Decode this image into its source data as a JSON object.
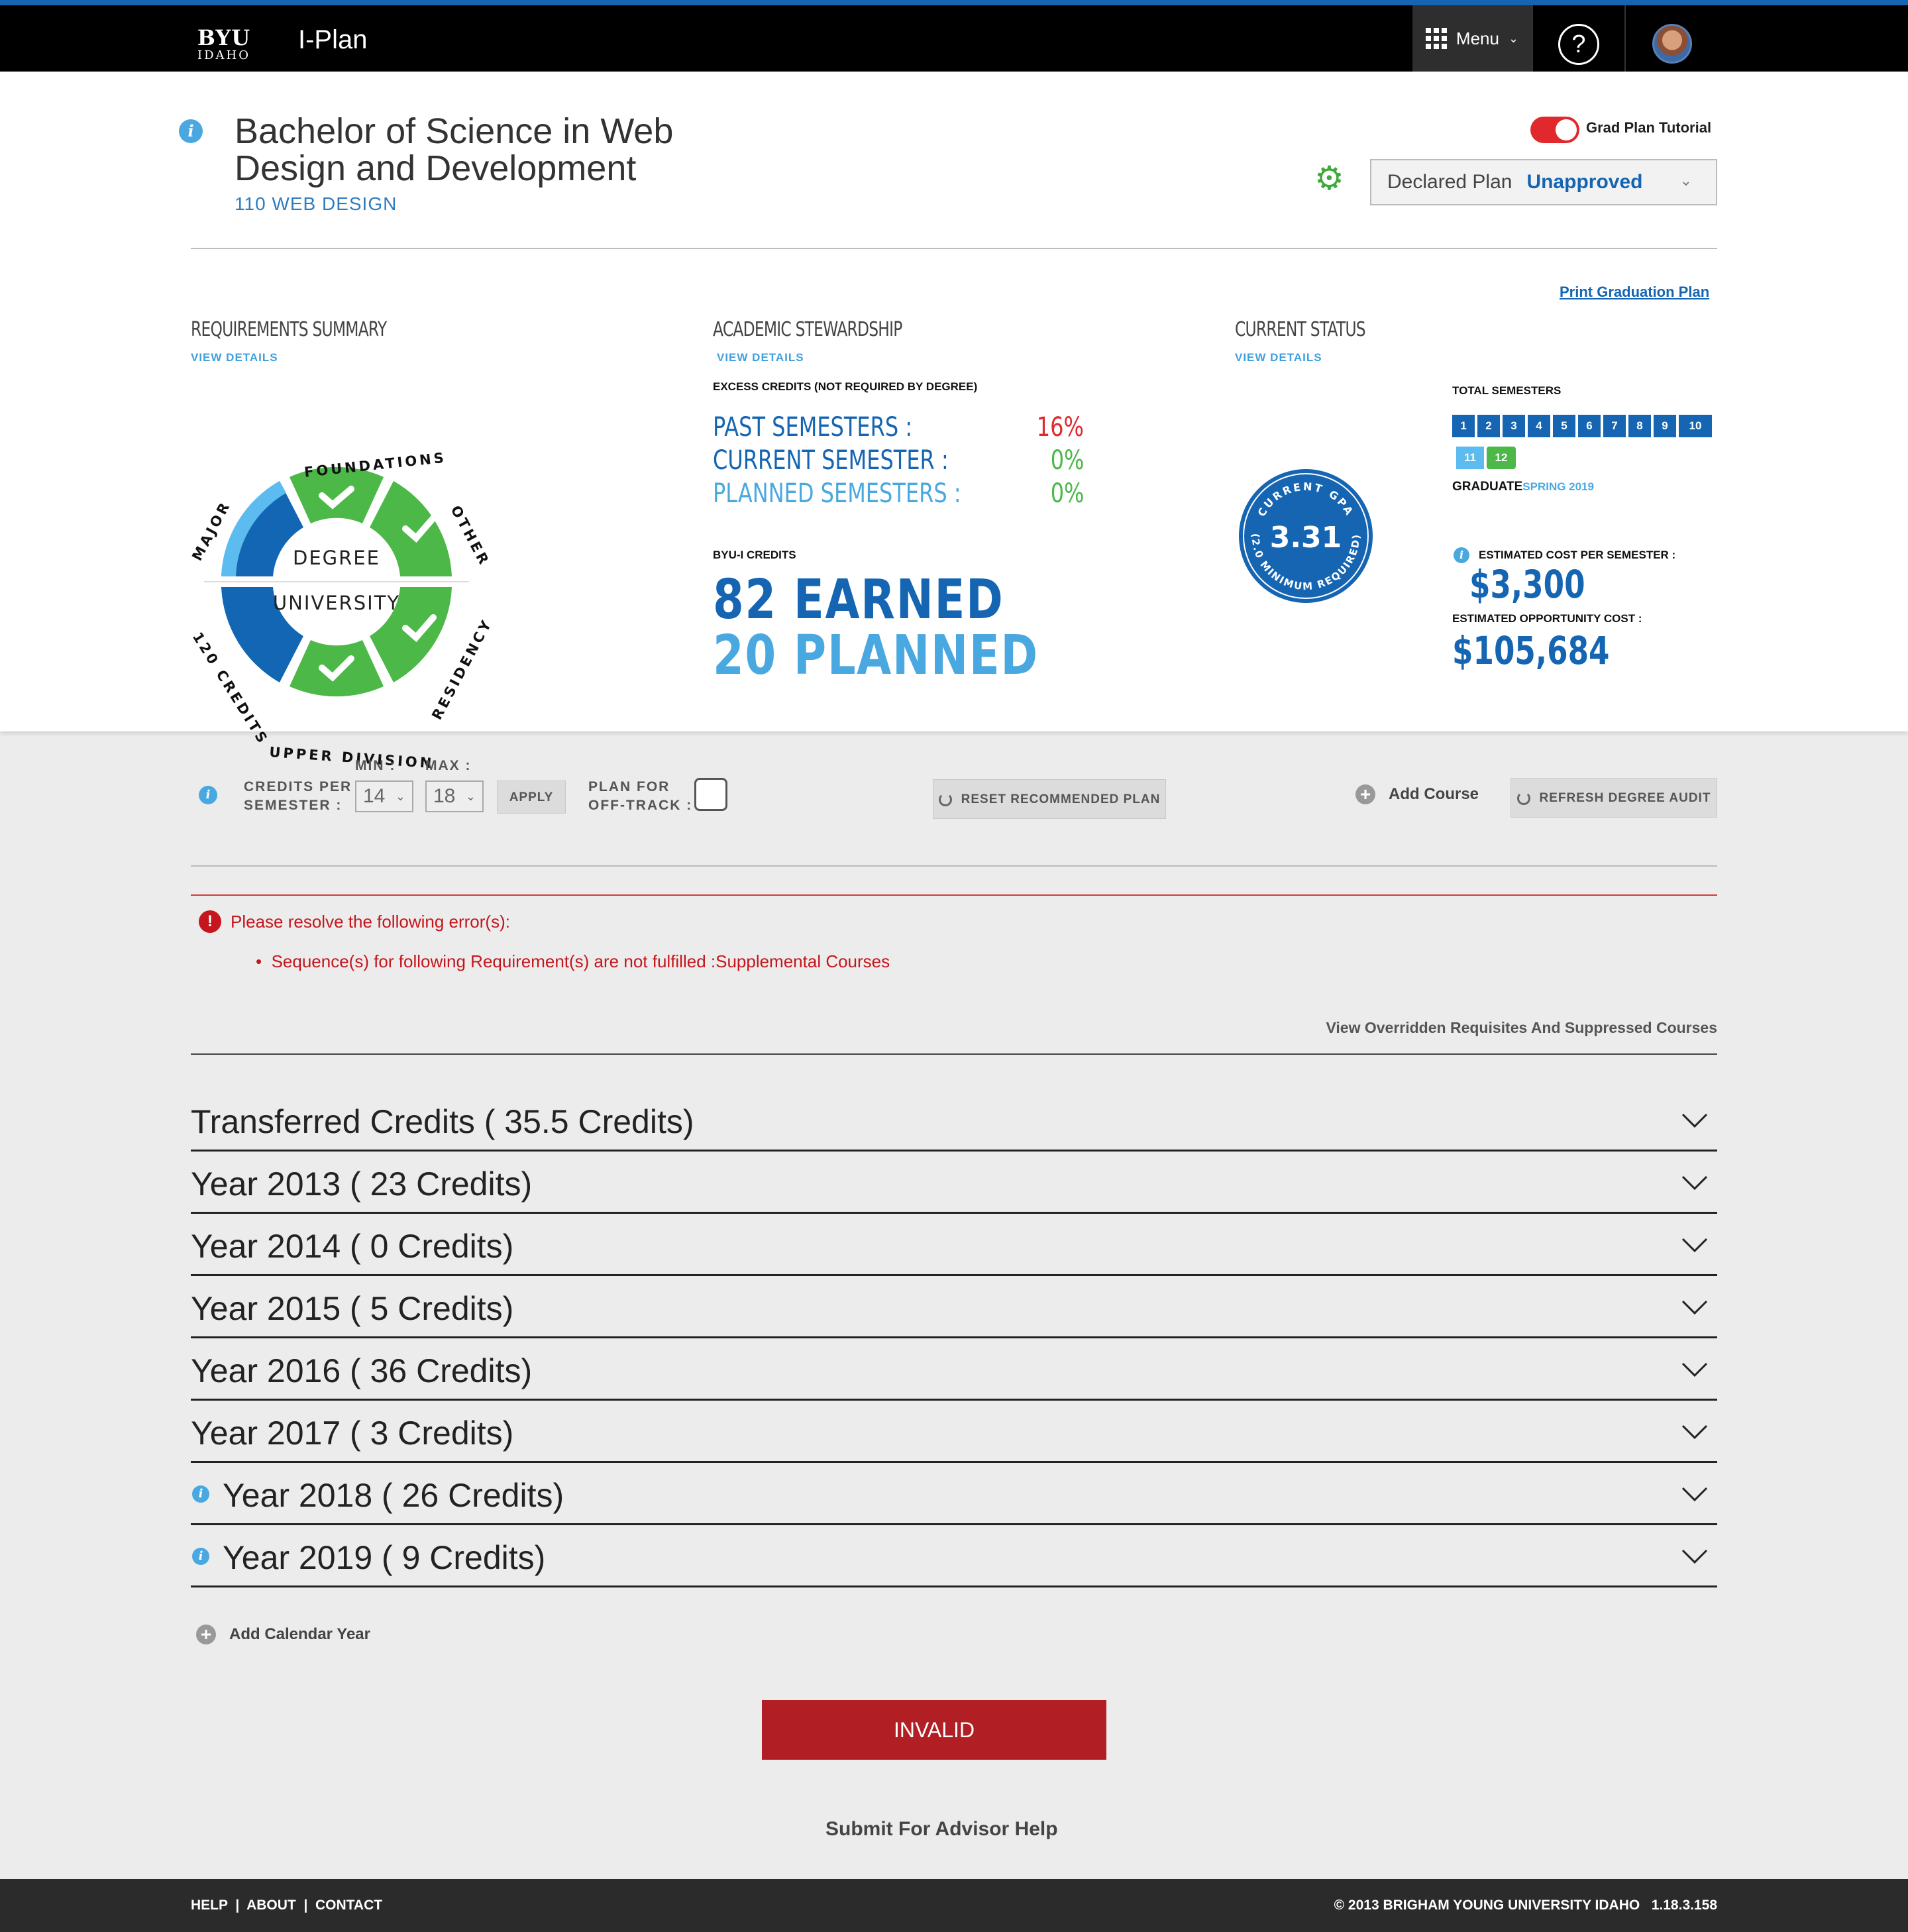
{
  "topbar": {
    "logo_top": "BYU",
    "logo_bottom": "IDAHO",
    "app_name": "I-Plan",
    "menu_label": "Menu",
    "help_label": "?"
  },
  "header": {
    "degree_title": "Bachelor of Science in Web Design and Development",
    "degree_code": "110 WEB DESIGN",
    "tutorial_label": "Grad Plan Tutorial",
    "tutorial_on": true,
    "plan_label": "Declared Plan",
    "plan_status": "Unapproved",
    "print_link": "Print Graduation Plan"
  },
  "requirements": {
    "heading": "REQUIREMENTS SUMMARY",
    "view_details": "VIEW DETAILS",
    "center_top": "DEGREE",
    "center_bottom": "UNIVERSITY",
    "segments": [
      {
        "name": "FOUNDATIONS",
        "complete": true
      },
      {
        "name": "OTHER",
        "complete": true
      },
      {
        "name": "RESIDENCY",
        "complete": true
      },
      {
        "name": "UPPER DIVISION",
        "complete": true
      },
      {
        "name": "120 CREDITS",
        "complete": false
      },
      {
        "name": "MAJOR",
        "complete": false
      }
    ]
  },
  "stewardship": {
    "heading": "ACADEMIC STEWARDSHIP",
    "view_details": "VIEW DETAILS",
    "excess_label": "EXCESS CREDITS (NOT REQUIRED BY DEGREE)",
    "rows": [
      {
        "label": "PAST SEMESTERS :",
        "value": "16%"
      },
      {
        "label": "CURRENT SEMESTER :",
        "value": "0%"
      },
      {
        "label": "PLANNED SEMESTERS :",
        "value": "0%"
      }
    ],
    "credits_label": "BYU-I CREDITS",
    "earned": "82 EARNED",
    "planned": "20 PLANNED"
  },
  "status": {
    "heading": "CURRENT STATUS",
    "view_details": "VIEW DETAILS",
    "gpa_top": "CURRENT GPA",
    "gpa_value": "3.31",
    "gpa_bottom": "(2.0 MINIMUM REQUIRED)",
    "total_semesters_label": "TOTAL SEMESTERS",
    "semesters": [
      "1",
      "2",
      "3",
      "4",
      "5",
      "6",
      "7",
      "8",
      "9",
      "10",
      "11",
      "12"
    ],
    "graduate_label": "GRADUATE",
    "graduate_term": "SPRING 2019",
    "cost_label": "ESTIMATED COST PER SEMESTER :",
    "cost_value": "$3,300",
    "opp_label": "ESTIMATED OPPORTUNITY COST :",
    "opp_value": "$105,684"
  },
  "controls": {
    "credits_label_1": "CREDITS PER",
    "credits_label_2": "SEMESTER :",
    "min_label": "MIN :",
    "min_value": "14",
    "max_label": "MAX :",
    "max_value": "18",
    "apply": "APPLY",
    "offtrack_1": "PLAN FOR",
    "offtrack_2": "OFF-TRACK :",
    "reset": "RESET RECOMMENDED PLAN",
    "add_course": "Add Course",
    "refresh": "REFRESH DEGREE AUDIT"
  },
  "errors": {
    "heading": "Please resolve the following error(s):",
    "items": [
      "Sequence(s) for following Requirement(s) are not fulfilled :Supplemental Courses"
    ]
  },
  "overridden_link": "View Overridden Requisites And Suppressed Courses",
  "years": [
    {
      "label": "Transferred Credits ( 35.5 Credits)",
      "info": false
    },
    {
      "label": "Year 2013 ( 23 Credits)",
      "info": false
    },
    {
      "label": "Year 2014 ( 0 Credits)",
      "info": false
    },
    {
      "label": "Year 2015 ( 5 Credits)",
      "info": false
    },
    {
      "label": "Year 2016 ( 36 Credits)",
      "info": false
    },
    {
      "label": "Year 2017 ( 3 Credits)",
      "info": false
    },
    {
      "label": "Year 2018 ( 26 Credits)",
      "info": true
    },
    {
      "label": "Year 2019 ( 9 Credits)",
      "info": true
    }
  ],
  "add_calendar_year": "Add Calendar Year",
  "invalid_button": "INVALID",
  "advisor_link": "Submit For Advisor Help",
  "footer": {
    "help": "HELP",
    "about": "ABOUT",
    "contact": "CONTACT",
    "copyright": "© 2013 BRIGHAM YOUNG UNIVERSITY IDAHO",
    "version": "1.18.3.158"
  },
  "colors": {
    "brand_blue": "#1565b3",
    "light_blue": "#4aa8e0",
    "green": "#4cb848",
    "error_red": "#c4161c"
  }
}
